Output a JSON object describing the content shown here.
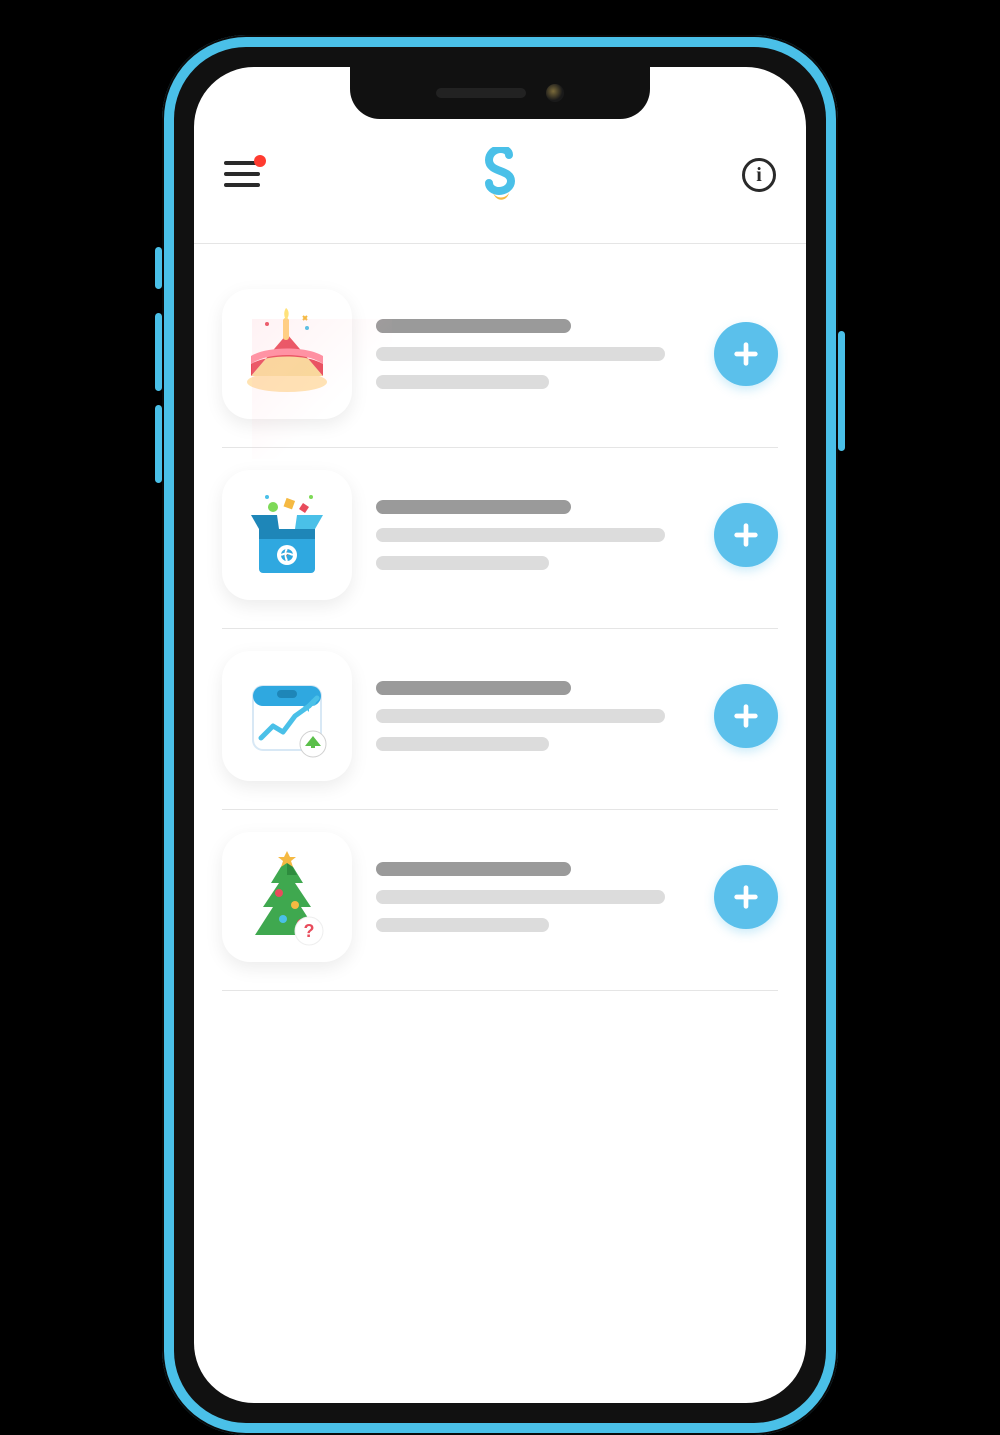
{
  "header": {
    "menu_label": "menu",
    "has_notification": true,
    "logo_name": "s-logo",
    "info_label": "i"
  },
  "colors": {
    "accent": "#5BC0EB",
    "notif": "#ff3b30"
  },
  "list": {
    "items": [
      {
        "icon": "birthday-cake-icon",
        "add_label": "+"
      },
      {
        "icon": "gift-box-icon",
        "add_label": "+"
      },
      {
        "icon": "calendar-chart-icon",
        "add_label": "+"
      },
      {
        "icon": "christmas-tree-icon",
        "add_label": "+"
      }
    ]
  }
}
